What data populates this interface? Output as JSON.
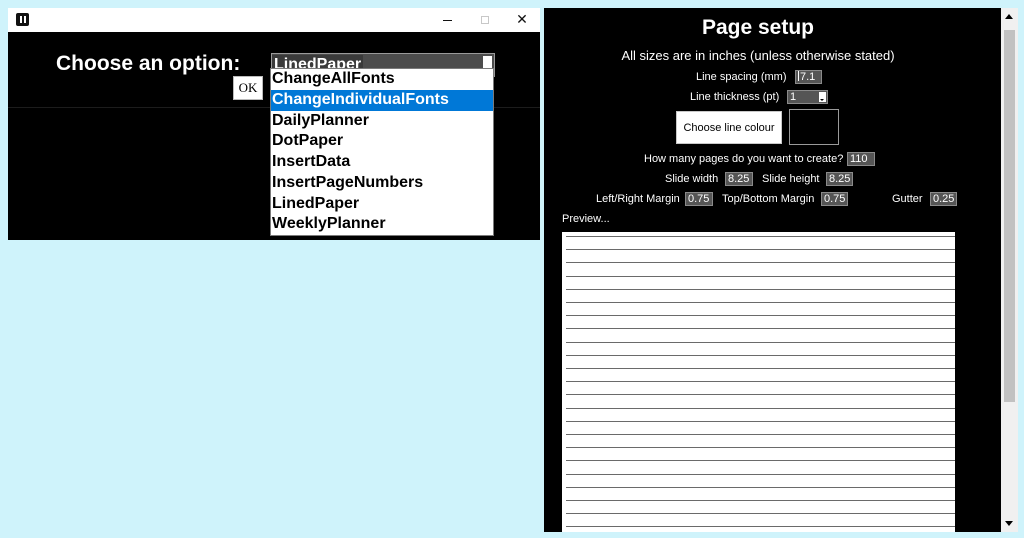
{
  "left_window": {
    "buttons": {
      "minimize": "minimize",
      "maximize": "maximize",
      "close": "close"
    },
    "choose_label": "Choose an option:",
    "combo_value": "LinedPaper",
    "ok_label": "OK",
    "options": [
      "ChangeAllFonts",
      "ChangeIndividualFonts",
      "DailyPlanner",
      "DotPaper",
      "InsertData",
      "InsertPageNumbers",
      "LinedPaper",
      "WeeklyPlanner"
    ],
    "highlighted_option": "ChangeIndividualFonts",
    "highlight_color": "#0078d7"
  },
  "page_setup": {
    "title": "Page setup",
    "subtitle": "All sizes are in inches (unless otherwise stated)",
    "line_spacing": {
      "label": "Line spacing (mm)",
      "value": "7.1"
    },
    "line_thickness": {
      "label": "Line thickness (pt)",
      "value": "1"
    },
    "colour_button": "Choose line colour",
    "line_colour": "#000000",
    "pages": {
      "label": "How many pages do you want to create?",
      "value": "110"
    },
    "slide_width": {
      "label": "Slide width",
      "value": "8.25"
    },
    "slide_height": {
      "label": "Slide height",
      "value": "8.25"
    },
    "lr_margin": {
      "label": "Left/Right Margin",
      "value": "0.75"
    },
    "tb_margin": {
      "label": "Top/Bottom Margin",
      "value": "0.75"
    },
    "gutter": {
      "label": "Gutter",
      "value": "0.25"
    },
    "preview_label": "Preview..."
  },
  "colors": {
    "desktop": "#cff3fb",
    "window_bg": "#000000"
  }
}
